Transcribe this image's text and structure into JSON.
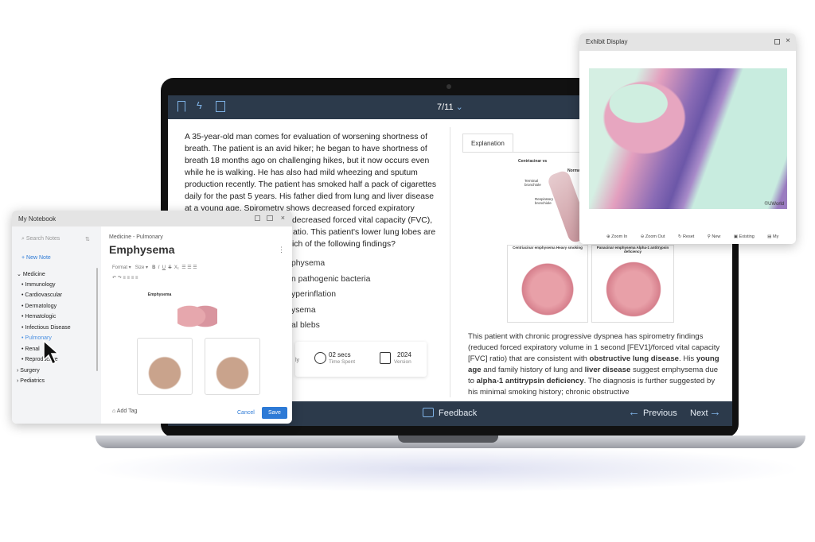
{
  "question_nav": {
    "counter": "7/11"
  },
  "question": {
    "lines": [
      "A 35-year-old man comes for evaluation of worsening shortness of",
      "breath.  The patient is an avid hiker; he began to have shortness of",
      "breath 18 months ago on challenging hikes, but it now occurs even",
      "while he is walking.  He has also had mild wheezing and sputum",
      "production recently.  The patient has smoked half a pack of cigarettes",
      "daily for the past 5 years.  His father died from lung and liver disease",
      "at a young age.  Spirometry shows decreased forced expiratory"
    ],
    "partial_lines": [
      "decreased forced vital capacity (FVC),",
      "atio.  This patient's lower lung lobes are",
      "ich of the following findings?"
    ],
    "options_partial": [
      "physema",
      "n pathogenic bacteria",
      "yperinflation",
      "ysema",
      "al blebs"
    ]
  },
  "stats": {
    "partial": "ly",
    "time_value": "02 secs",
    "time_label": "Time Spent",
    "version_value": "2024",
    "version_label": "Version"
  },
  "explanation": {
    "tab": "Explanation",
    "figure_labels": [
      "Centriacinar vs",
      "Norma",
      "Terminal bronchiole",
      "Respiratory bronchiole",
      "Centriacinar emphysema Heavy smoking",
      "Panacinar emphysema Alpha-1 antitrypsin deficiency"
    ],
    "paragraph_html": "This patient with chronic progressive dyspnea has spirometry findings (reduced forced expiratory volume in 1 second [FEV1]/forced vital capacity [FVC] ratio) that are consistent with <b>obstructive lung disease</b>. His <b>young age</b> and family history of lung and <b>liver disease</b> suggest emphysema due to <b>alpha-1 antitrypsin deficiency</b>.  The diagnosis is further suggested by his minimal smoking history; chronic obstructive"
  },
  "footer": {
    "feedback": "Feedback",
    "previous": "Previous",
    "next": "Next"
  },
  "notebook": {
    "title": "My Notebook",
    "search_placeholder": "Search Notes",
    "new_note": "New Note",
    "tree": [
      {
        "label": "Medicine",
        "expanded": true,
        "children": [
          "Immunology",
          "Cardiovascular",
          "Dermatology",
          "Hematologic",
          "Infectious Disease",
          "Pulmonary",
          "Renal",
          "Reproductive"
        ],
        "selected": "Pulmonary"
      },
      {
        "label": "Surgery"
      },
      {
        "label": "Pediatrics"
      }
    ],
    "breadcrumb": "Medicine - Pulmonary",
    "note_title": "Emphysema",
    "format": "Format",
    "size": "Size",
    "image_title": "Emphysema",
    "add_tag": "Add Tag",
    "cancel": "Cancel",
    "save": "Save"
  },
  "exhibit": {
    "title": "Exhibit Display",
    "copyright": "©UWorld",
    "tools": [
      "Zoom In",
      "Zoom Out",
      "Reset",
      "New",
      "Existing",
      "My Notebook"
    ]
  },
  "colors": {
    "nav": "#2c3a4b",
    "accent": "#2d7ad6"
  }
}
